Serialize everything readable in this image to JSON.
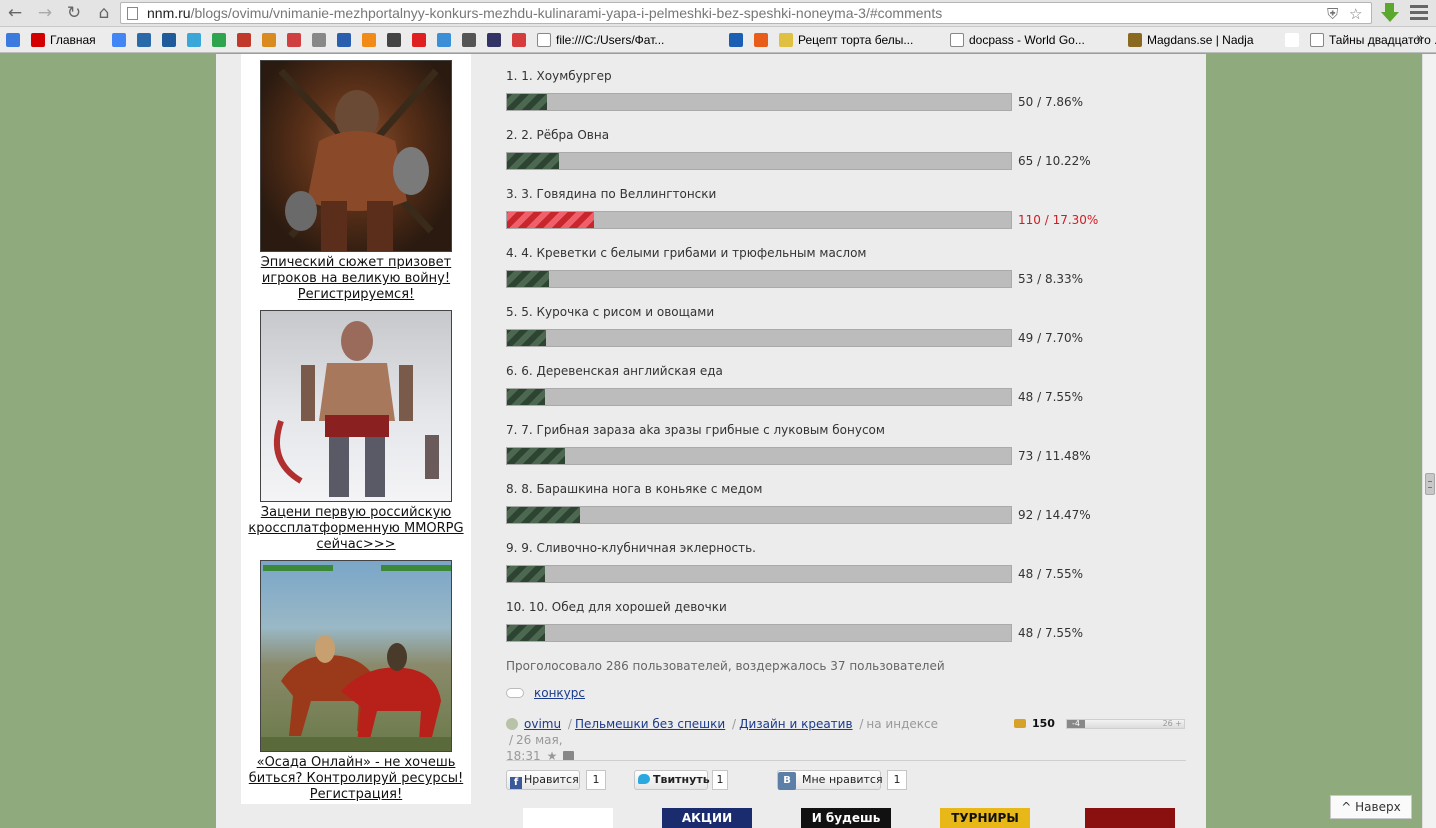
{
  "browser": {
    "url_host": "nnm.ru",
    "url_path": "/blogs/ovimu/vnimanie-mezhportalnyy-konkurs-mezhdu-kulinarami-yapa-i-pelmeshki-bez-speshki-noneyma-3/#comments",
    "bookmarks": [
      {
        "icon": "translate-icon",
        "label": "",
        "color": "#3b7be0"
      },
      {
        "icon": "yandex-icon",
        "label": "Главная",
        "color": "#d40000"
      },
      {
        "icon": "google-icon",
        "label": "",
        "color": "#4285f4"
      },
      {
        "icon": "site-icon",
        "label": "",
        "color": "#2b6aa8"
      },
      {
        "icon": "site-icon",
        "label": "",
        "color": "#1f5a9a"
      },
      {
        "icon": "flower-icon",
        "label": "",
        "color": "#3ba7d8"
      },
      {
        "icon": "check-icon",
        "label": "",
        "color": "#2ea44f"
      },
      {
        "icon": "apple-icon",
        "label": "",
        "color": "#c0392b"
      },
      {
        "icon": "tag-icon",
        "label": "",
        "color": "#d98b1f"
      },
      {
        "icon": "site-icon",
        "label": "",
        "color": "#d04040"
      },
      {
        "icon": "dice-icon",
        "label": "",
        "color": "#888888"
      },
      {
        "icon": "flag-icon",
        "label": "",
        "color": "#2a5fb0"
      },
      {
        "icon": "odnoklassniki-icon",
        "label": "",
        "color": "#f28a18"
      },
      {
        "icon": "arrow-icon",
        "label": "",
        "color": "#444444"
      },
      {
        "icon": "youtube-icon",
        "label": "",
        "color": "#e02020"
      },
      {
        "icon": "site-icon",
        "label": "",
        "color": "#3a8fd6"
      },
      {
        "icon": "wikipedia-icon",
        "label": "",
        "color": "#555555"
      },
      {
        "icon": "person-icon",
        "label": "",
        "color": "#333366"
      },
      {
        "icon": "site-icon",
        "label": "",
        "color": "#d63c3c"
      },
      {
        "icon": "file-icon",
        "label": "file:///C:/Users/Фат...",
        "color": "#ffffff"
      },
      {
        "icon": "n-icon",
        "label": "",
        "color": "#1a5fb4"
      },
      {
        "icon": "k-icon",
        "label": "",
        "color": "#e85d1a"
      },
      {
        "icon": "smile-icon",
        "label": "Рецепт торта белы...",
        "color": "#e0c040"
      },
      {
        "icon": "file-icon",
        "label": "docpass - World Go...",
        "color": "#ffffff"
      },
      {
        "icon": "magdans-icon",
        "label": "Magdans.se | Nadja",
        "color": "#8a6a20"
      },
      {
        "icon": "file-icon",
        "label": "",
        "color": "#ffffff"
      },
      {
        "icon": "b-icon",
        "label": "Тайны двадцатого ...",
        "color": "#ffffff"
      }
    ],
    "more_label": "»"
  },
  "ads": [
    {
      "caption": "Эпический сюжет призовет игроков на великую войну! Регистрируемся!"
    },
    {
      "caption": "Зацени первую российскую кроссплатформенную MMORPG сейчас>>>"
    },
    {
      "caption": "«Осада Онлайн» - не хочешь биться? Контролируй ресурсы! Регистрация!"
    }
  ],
  "poll": {
    "options": [
      {
        "label": "1. 1. Хоумбургер",
        "votes": 50,
        "percent": 7.86,
        "result": "50 / 7.86%",
        "leader": false
      },
      {
        "label": "2. 2. Рёбра Овна",
        "votes": 65,
        "percent": 10.22,
        "result": "65 / 10.22%",
        "leader": false
      },
      {
        "label": "3. 3. Говядина по Веллингтонски",
        "votes": 110,
        "percent": 17.3,
        "result": "110 / 17.30%",
        "leader": true
      },
      {
        "label": "4. 4. Креветки с белыми грибами и трюфельным маслом",
        "votes": 53,
        "percent": 8.33,
        "result": "53 / 8.33%",
        "leader": false
      },
      {
        "label": "5. 5. Курочка с рисом и овощами",
        "votes": 49,
        "percent": 7.7,
        "result": "49 / 7.70%",
        "leader": false
      },
      {
        "label": "6. 6. Деревенская английская еда",
        "votes": 48,
        "percent": 7.55,
        "result": "48 / 7.55%",
        "leader": false
      },
      {
        "label": "7. 7. Грибная зараза aka зразы грибные с луковым бонусом",
        "votes": 73,
        "percent": 11.48,
        "result": "73 / 11.48%",
        "leader": false
      },
      {
        "label": "8. 8. Барашкина нога в коньяке с медом",
        "votes": 92,
        "percent": 14.47,
        "result": "92 / 14.47%",
        "leader": false
      },
      {
        "label": "9. 9. Сливочно-клубничная эклерность.",
        "votes": 48,
        "percent": 7.55,
        "result": "48 / 7.55%",
        "leader": false
      },
      {
        "label": "10. 10. Обед для хорошей девочки",
        "votes": 48,
        "percent": 7.55,
        "result": "48 / 7.55%",
        "leader": false
      }
    ],
    "total_text": "Проголосовало 286 пользователей, воздержалось 37 пользователей"
  },
  "post": {
    "tag": "конкурс",
    "author": "ovimu",
    "blog1": "Пельмешки без спешки",
    "blog2": "Дизайн и креатив",
    "status": "на индексе",
    "date": "26 мая,",
    "time": "18:31",
    "comments_count": "150",
    "rating_neg": "-4",
    "rating_pos": "26 +"
  },
  "share": {
    "facebook_label": "Нравится",
    "facebook_count": "1",
    "twitter_label": "Твитнуть",
    "twitter_count": "1",
    "vk_icon_label": "В",
    "vk_label": "Мне нравится",
    "vk_count": "1"
  },
  "banners": [
    {
      "text": "",
      "bg": "#ffffff",
      "fg": "#000000"
    },
    {
      "text": "АКЦИИ",
      "bg": "#1a2c6e",
      "fg": "#ffffff"
    },
    {
      "text": "И будешь",
      "bg": "#111111",
      "fg": "#ffffff"
    },
    {
      "text": "ТУРНИРЫ",
      "bg": "#e8b818",
      "fg": "#111111"
    },
    {
      "text": "",
      "bg": "#8a1010",
      "fg": "#ffffff"
    }
  ],
  "to_top_label": "^ Наверх",
  "colors": {
    "leader": "#d01c24",
    "bar": "#2e4433",
    "link": "#1a3a8c"
  }
}
